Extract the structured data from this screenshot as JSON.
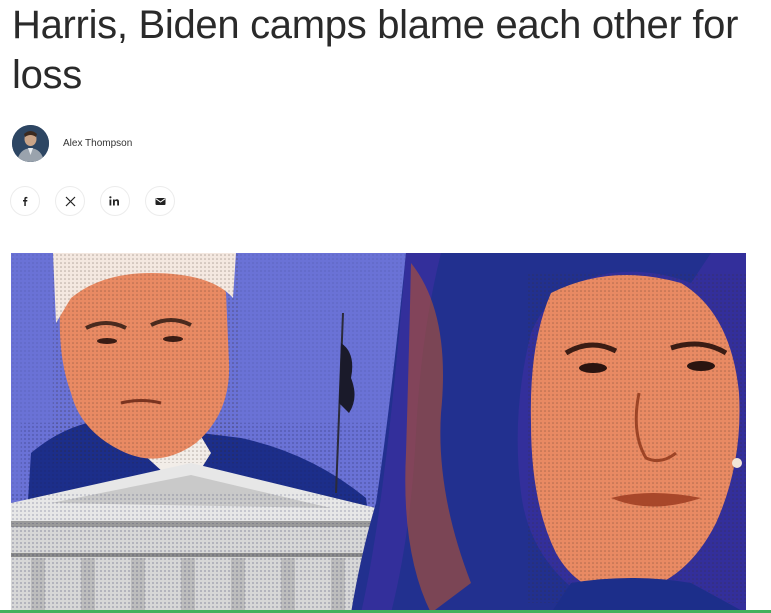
{
  "article": {
    "headline": "Harris, Biden camps blame each other for loss",
    "author": "Alex Thompson"
  },
  "share": [
    {
      "network": "facebook",
      "icon": "facebook-icon"
    },
    {
      "network": "x",
      "icon": "x-icon"
    },
    {
      "network": "linkedin",
      "icon": "linkedin-icon"
    },
    {
      "network": "email",
      "icon": "email-icon"
    }
  ],
  "colors": {
    "headline_text": "#2a2a2a",
    "hero_sky": "#6a72d6",
    "hero_navy": "#1c2e8a",
    "hero_skin": "#e98a63",
    "accent_line": "#43b05c"
  }
}
